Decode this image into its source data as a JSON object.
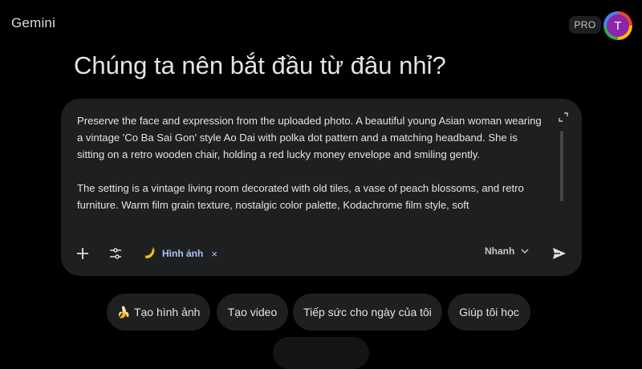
{
  "app": {
    "title": "Gemini"
  },
  "account": {
    "plan_badge": "PRO",
    "avatar_initial": "T"
  },
  "headline": "Chúng ta nên bắt đầu từ đâu nhỉ?",
  "composer": {
    "prompt_text": "Preserve the face and expression from the uploaded photo. A beautiful young Asian woman wearing a vintage 'Co Ba Sai Gon' style Ao Dai with polka dot pattern and a matching headband. She is sitting on a retro wooden chair, holding a red lucky money envelope and smiling gently.\n\nThe setting is a vintage living room decorated with old tiles, a vase of peach blossoms, and retro furniture. Warm film grain texture, nostalgic color palette, Kodachrome film style, soft",
    "tool_chip": {
      "icon": "banana-icon",
      "label": "Hình ảnh",
      "close": "×"
    },
    "mode": {
      "selected": "Nhanh"
    }
  },
  "suggestions": [
    {
      "emoji": "🍌",
      "label": "Tạo hình ảnh"
    },
    {
      "label": "Tạo video"
    },
    {
      "label": "Tiếp sức cho ngày của tôi"
    },
    {
      "label": "Giúp tôi học"
    }
  ],
  "colors": {
    "background": "#000000",
    "surface": "#1e1f20",
    "accent_text": "#a8c7fa",
    "avatar": "#8e24aa"
  }
}
